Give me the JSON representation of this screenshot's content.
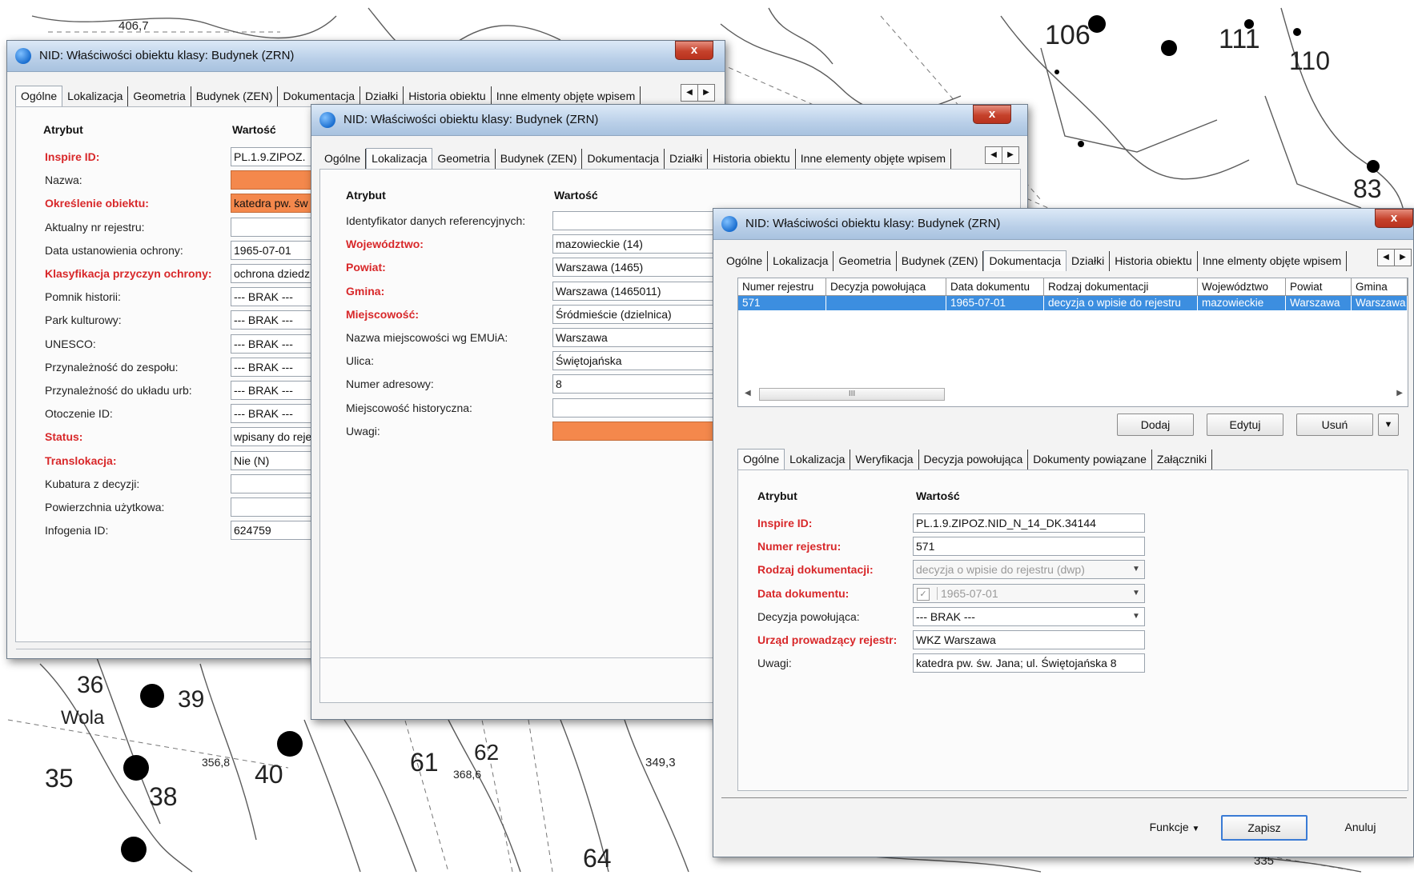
{
  "map": {
    "labels": [
      "406,7",
      "106",
      "111",
      "110",
      "83",
      "36",
      "39",
      "Wola",
      "35",
      "356,8",
      "40",
      "38",
      "61",
      "62",
      "368,6",
      "349,3",
      "64",
      "335"
    ]
  },
  "colors": {
    "required": "#d8282a",
    "highlight_field": "#f4884c",
    "selection": "#3c8ee0"
  },
  "win1": {
    "title": "NID: Właściwości obiektu klasy: Budynek (ZRN)",
    "close": "x",
    "tabs": [
      "Ogólne",
      "Lokalizacja",
      "Geometria",
      "Budynek (ZEN)",
      "Dokumentacja",
      "Działki",
      "Historia obiektu",
      "Inne elmenty objęte wpisem"
    ],
    "active_tab": "Ogólne",
    "col_attr": "Atrybut",
    "col_val": "Wartość",
    "rows": [
      {
        "label": "Inspire ID:",
        "value": "PL.1.9.ZIPOZ.",
        "required": true,
        "style": ""
      },
      {
        "label": "Nazwa:",
        "value": "",
        "required": false,
        "style": "orange"
      },
      {
        "label": "Określenie obiektu:",
        "value": "katedra pw. św",
        "required": true,
        "style": "orange"
      },
      {
        "label": "Aktualny nr rejestru:",
        "value": "",
        "required": false,
        "style": ""
      },
      {
        "label": "Data ustanowienia ochrony:",
        "value": "1965-07-01",
        "required": false,
        "style": ""
      },
      {
        "label": "Klasyfikacja przyczyn ochrony:",
        "value": "ochrona dziedz",
        "required": true,
        "style": ""
      },
      {
        "label": "Pomnik historii:",
        "value": "--- BRAK ---",
        "required": false,
        "style": ""
      },
      {
        "label": "Park kulturowy:",
        "value": "--- BRAK ---",
        "required": false,
        "style": ""
      },
      {
        "label": "UNESCO:",
        "value": "--- BRAK ---",
        "required": false,
        "style": ""
      },
      {
        "label": "Przynależność do zespołu:",
        "value": "--- BRAK ---",
        "required": false,
        "style": ""
      },
      {
        "label": "Przynależność do układu urb:",
        "value": "--- BRAK ---",
        "required": false,
        "style": ""
      },
      {
        "label": "Otoczenie ID:",
        "value": "--- BRAK ---",
        "required": false,
        "style": ""
      },
      {
        "label": "Status:",
        "value": "wpisany do reje",
        "required": true,
        "style": ""
      },
      {
        "label": "Translokacja:",
        "value": "Nie (N)",
        "required": true,
        "style": ""
      },
      {
        "label": "Kubatura z decyzji:",
        "value": "",
        "required": false,
        "style": ""
      },
      {
        "label": "Powierzchnia użytkowa:",
        "value": "",
        "required": false,
        "style": ""
      },
      {
        "label": "Infogenia ID:",
        "value": "624759",
        "required": false,
        "style": ""
      }
    ]
  },
  "win2": {
    "title": "NID: Właściwości obiektu klasy: Budynek (ZRN)",
    "close": "x",
    "tabs": [
      "Ogólne",
      "Lokalizacja",
      "Geometria",
      "Budynek (ZEN)",
      "Dokumentacja",
      "Działki",
      "Historia obiektu",
      "Inne elementy objęte wpisem"
    ],
    "active_tab": "Lokalizacja",
    "col_attr": "Atrybut",
    "col_val": "Wartość",
    "rows": [
      {
        "label": "Identyfikator danych referencyjnych:",
        "value": "",
        "required": false,
        "style": ""
      },
      {
        "label": "Województwo:",
        "value": "mazowieckie (14)",
        "required": true,
        "style": ""
      },
      {
        "label": "Powiat:",
        "value": "Warszawa (1465)",
        "required": true,
        "style": ""
      },
      {
        "label": "Gmina:",
        "value": "Warszawa (1465011)",
        "required": true,
        "style": ""
      },
      {
        "label": "Miejscowość:",
        "value": "Śródmieście (dzielnica)",
        "required": true,
        "style": ""
      },
      {
        "label": "Nazwa miejscowości wg EMUiA:",
        "value": "Warszawa",
        "required": false,
        "style": ""
      },
      {
        "label": "Ulica:",
        "value": "Świętojańska",
        "required": false,
        "style": ""
      },
      {
        "label": "Numer adresowy:",
        "value": "8",
        "required": false,
        "style": ""
      },
      {
        "label": "Miejscowość historyczna:",
        "value": "",
        "required": false,
        "style": ""
      },
      {
        "label": "Uwagi:",
        "value": "",
        "required": false,
        "style": "orange"
      }
    ]
  },
  "win3": {
    "title": "NID: Właściwości obiektu klasy: Budynek (ZRN)",
    "close": "x",
    "tabs": [
      "Ogólne",
      "Lokalizacja",
      "Geometria",
      "Budynek (ZEN)",
      "Dokumentacja",
      "Działki",
      "Historia obiektu",
      "Inne elmenty objęte wpisem"
    ],
    "active_tab": "Dokumentacja",
    "grid": {
      "columns": [
        "Numer rejestru",
        "Decyzja powołująca",
        "Data dokumentu",
        "Rodzaj dokumentacji",
        "Województwo",
        "Powiat",
        "Gmina"
      ],
      "rows": [
        [
          "571",
          "",
          "1965-07-01",
          "decyzja o wpisie do rejestru",
          "mazowieckie",
          "Warszawa",
          "Warszawa"
        ]
      ]
    },
    "scroll_thumb": "III",
    "buttons": {
      "add": "Dodaj",
      "edit": "Edytuj",
      "delete": "Usuń"
    },
    "subtabs": [
      "Ogólne",
      "Lokalizacja",
      "Weryfikacja",
      "Decyzja powołująca",
      "Dokumenty powiązane",
      "Załączniki"
    ],
    "active_subtab": "Ogólne",
    "col_attr": "Atrybut",
    "col_val": "Wartość",
    "rows": [
      {
        "label": "Inspire ID:",
        "value": "PL.1.9.ZIPOZ.NID_N_14_DK.34144",
        "required": true,
        "kind": "text"
      },
      {
        "label": "Numer rejestru:",
        "value": "571",
        "required": true,
        "kind": "text"
      },
      {
        "label": "Rodzaj dokumentacji:",
        "value": "decyzja o wpisie do rejestru (dwp)",
        "required": true,
        "kind": "select-disabled"
      },
      {
        "label": "Data dokumentu:",
        "value": "1965-07-01",
        "required": true,
        "kind": "date-disabled"
      },
      {
        "label": "Decyzja powołująca:",
        "value": "--- BRAK ---",
        "required": false,
        "kind": "select"
      },
      {
        "label": "Urząd prowadzący rejestr:",
        "value": "WKZ Warszawa",
        "required": true,
        "kind": "text"
      },
      {
        "label": "Uwagi:",
        "value": "katedra pw. św. Jana; ul. Świętojańska 8",
        "required": false,
        "kind": "text"
      }
    ],
    "footer": {
      "functions": "Funkcje",
      "save": "Zapisz",
      "cancel": "Anuluj"
    }
  }
}
